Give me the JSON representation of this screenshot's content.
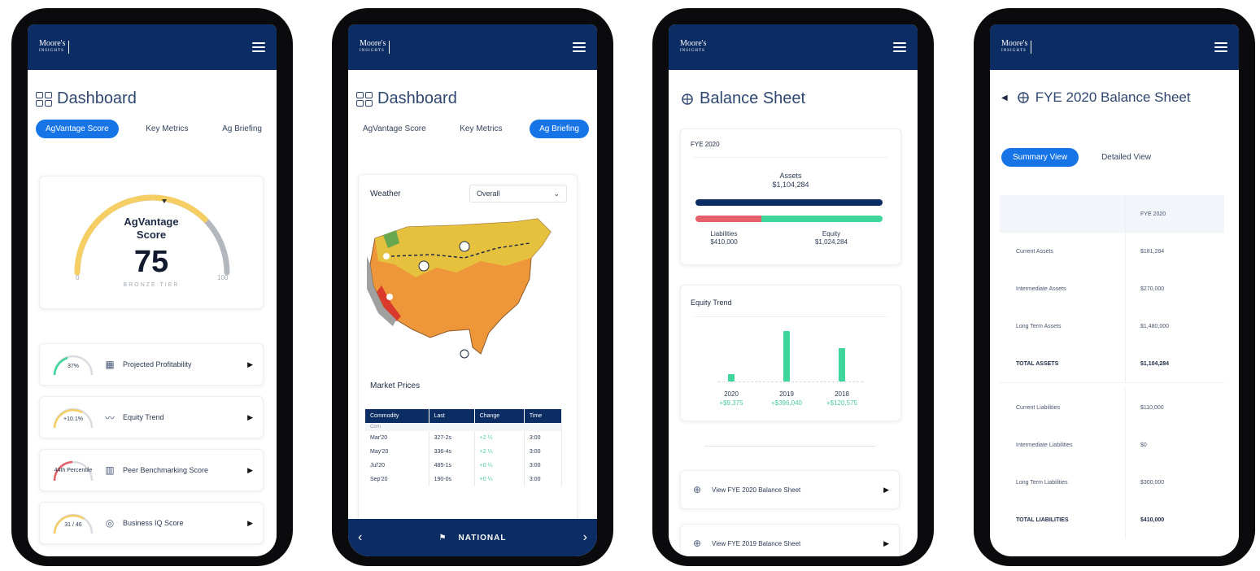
{
  "brand": {
    "logo_text": "Moore's",
    "logo_sub": "INSIGHTS"
  },
  "colors": {
    "navy": "#0c2d63",
    "accent_blue": "#1774e6",
    "green": "#3ed69b",
    "red": "#e66069",
    "gauge_yellow": "#f5cf63",
    "gauge_gray": "#b3b7be"
  },
  "phone1": {
    "title": "Dashboard",
    "tabs": [
      "AgVantage Score",
      "Key Metrics",
      "Ag Briefing"
    ],
    "gauge": {
      "label_line1": "AgVantage",
      "label_line2": "Score",
      "value": "75",
      "tier": "BRONZE TIER",
      "min": "0",
      "max": "100",
      "level": 0.75
    },
    "metrics": [
      {
        "gauge_text": "37%",
        "label": "Projected Profitability",
        "icon": "bar-chart-icon"
      },
      {
        "gauge_text": "+10.1%",
        "label": "Equity Trend",
        "icon": "trend-icon"
      },
      {
        "gauge_text": "44th Percentile",
        "label": "Peer Benchmarking Score",
        "icon": "people-chart-icon"
      },
      {
        "gauge_text": "31 / 46",
        "label": "Business IQ Score",
        "icon": "chat-icon"
      }
    ]
  },
  "phone2": {
    "title": "Dashboard",
    "tabs": [
      "AgVantage Score",
      "Key Metrics",
      "Ag Briefing"
    ],
    "weather": {
      "label": "Weather",
      "select_value": "Overall"
    },
    "market": {
      "label": "Market Prices",
      "headers": [
        "Commodity",
        "Last",
        "Change",
        "Time"
      ],
      "group": "Corn",
      "rows": [
        [
          "Mar'20",
          "327-2s",
          "+2 ¼",
          "3:00"
        ],
        [
          "May'20",
          "336-4s",
          "+2 ¼",
          "3:00"
        ],
        [
          "Jul'20",
          "485-1s",
          "+0 ¼",
          "3:00"
        ],
        [
          "Sep'20",
          "190-0s",
          "+0 ¼",
          "3:00"
        ]
      ]
    },
    "bottom_nav": {
      "label": "NATIONAL"
    }
  },
  "phone3": {
    "title": "Balance Sheet",
    "summary": {
      "period": "FYE 2020",
      "assets_label": "Assets",
      "assets_value": "$1,104,284",
      "liabilities_label": "Liabilities",
      "liabilities_value": "$410,000",
      "equity_label": "Equity",
      "equity_value": "$1,024,284",
      "liabilities_share": 0.35
    },
    "equity_trend": {
      "label": "Equity Trend",
      "chart_data": {
        "type": "bar",
        "categories": [
          "2020",
          "2019",
          "2018"
        ],
        "values": [
          8,
          58,
          38
        ],
        "changes": [
          "+$9,375",
          "+$396,040",
          "+$120,575"
        ]
      }
    },
    "links": [
      "View FYE 2020 Balance Sheet",
      "View FYE 2019 Balance Sheet"
    ]
  },
  "phone4": {
    "title": "FYE 2020 Balance Sheet",
    "view_tabs": [
      "Summary View",
      "Detailed View"
    ],
    "column_header": "FYE 2020",
    "rows": [
      {
        "label": "Current Assets",
        "value": "$181,284"
      },
      {
        "label": "Intermediate Assets",
        "value": "$270,000"
      },
      {
        "label": "Long Term Assets",
        "value": "$1,480,000"
      },
      {
        "label": "TOTAL ASSETS",
        "value": "$1,104,284",
        "total": true
      },
      {
        "label": "Current Liabilities",
        "value": "$110,000"
      },
      {
        "label": "Intermediate Liabilities",
        "value": "$0"
      },
      {
        "label": "Long Term Liabilities",
        "value": "$300,000"
      },
      {
        "label": "TOTAL LIABILITIES",
        "value": "$410,000",
        "total": true
      }
    ]
  }
}
